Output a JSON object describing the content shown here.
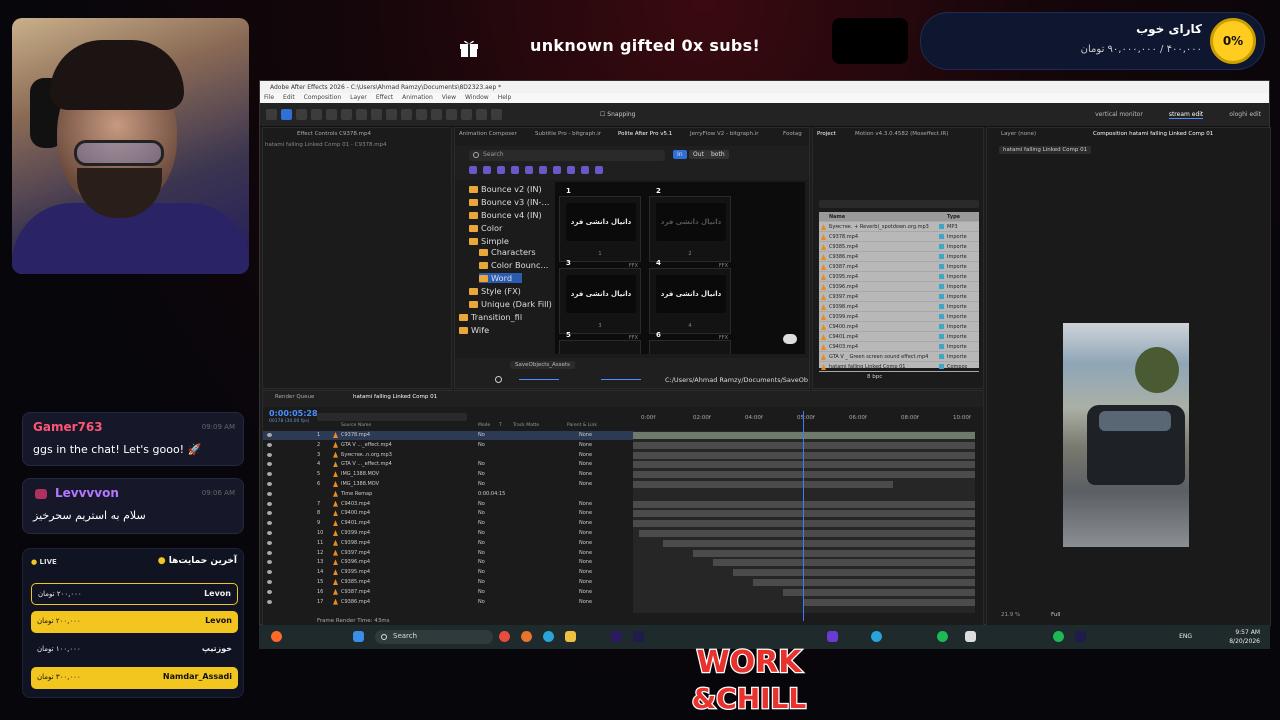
{
  "overlay": {
    "gift_text": "unknown gifted 0x subs!",
    "goal": {
      "title": "کارای خوب",
      "progress": "۴۰۰,۰۰۰ / ۹۰,۰۰۰,۰۰۰ تومان",
      "percent": "0%"
    },
    "chat": [
      {
        "user": "Gamer763",
        "time": "09:09 AM",
        "message": "ggs in the chat! Let's gooo! 🚀",
        "color": "#ff5577"
      },
      {
        "user": "Levvvvon",
        "time": "09:06 AM",
        "message": "سلام به استریم سحرخیز",
        "color": "#b477ff"
      }
    ],
    "support": {
      "live_label": "LIVE",
      "title": "آخرین حمایت‌ها",
      "rows": [
        {
          "name": "Levon",
          "amount": "۲۰۰,۰۰۰ تومان"
        },
        {
          "name": "Levon",
          "amount": "۲۰۰,۰۰۰ تومان"
        },
        {
          "name": "خوزتیپ",
          "amount": "۱۰۰,۰۰۰ تومان"
        },
        {
          "name": "Namdar_Assadi",
          "amount": "۳۰۰,۰۰۰ تومان"
        }
      ]
    },
    "logo_text": [
      "WORK",
      "&CHILL"
    ]
  },
  "app": {
    "title": "Adobe After Effects 2026 - C:\\Users\\Ahmad Ramzy\\Documents\\8D2323.aep *",
    "menu": [
      "File",
      "Edit",
      "Composition",
      "Layer",
      "Effect",
      "Animation",
      "View",
      "Window",
      "Help"
    ],
    "snapping": "Snapping",
    "workspaces": [
      "vertical monitor",
      "stream edit",
      "ologhi edit"
    ],
    "effect_controls_tab": "Effect Controls C9378.mp4",
    "effect_controls_sub": "hatami falling Linked Comp 01 - C9378.mp4",
    "ac_tabs": [
      "Animation Composer",
      "Subtitle Pro - bitgraph.ir",
      "Polite After Pro v5.1",
      "JerryFlow V2 - bitgraph.ir",
      "Footag"
    ],
    "project_tabs": [
      "Project",
      "Motion v4.3.0.4582 (Moxeffect.IR)"
    ],
    "comp_tabs": [
      "Layer (none)",
      "Composition hatami falling Linked Comp 01"
    ],
    "comp_crumb": "hatami falling Linked Comp 01",
    "search_placeholder": "Search",
    "filters": [
      "In",
      "Out",
      "both"
    ],
    "tree": [
      {
        "label": "Bounce v2 (IN)",
        "indent": 0
      },
      {
        "label": "Bounce v3 (IN-...",
        "indent": 0
      },
      {
        "label": "Bounce v4 (IN)",
        "indent": 0
      },
      {
        "label": "Color",
        "indent": 0
      },
      {
        "label": "Simple",
        "indent": 0
      },
      {
        "label": "Characters",
        "indent": 1
      },
      {
        "label": "Color Bounc...",
        "indent": 1
      },
      {
        "label": "Word",
        "indent": 1,
        "selected": true
      },
      {
        "label": "Style (FX)",
        "indent": 0
      },
      {
        "label": "Unique (Dark Fill)",
        "indent": 0
      },
      {
        "label": "Transition_fil",
        "indent": -1
      },
      {
        "label": "Wife",
        "indent": -1
      }
    ],
    "presets": [
      {
        "num": "1",
        "preview": "دانیال دانشی فرد",
        "sub": "1",
        "ffx": "FFX"
      },
      {
        "num": "2",
        "preview": "دانیال دانشی فرد",
        "sub": "2",
        "ffx": "FFX"
      },
      {
        "num": "3",
        "preview": "دانیال دانشی فرد",
        "sub": "3",
        "ffx": "FFX"
      },
      {
        "num": "4",
        "preview": "دانیال دانشی فرد",
        "sub": "4",
        "ffx": "FFX"
      },
      {
        "num": "5",
        "preview": "",
        "sub": "",
        "ffx": ""
      },
      {
        "num": "6",
        "preview": "",
        "sub": "",
        "ffx": ""
      }
    ],
    "preset_label": "SaveObjects_Assets",
    "path": "C:/Users/Ahmad Ramzy/Documents/SaveOb",
    "project_columns": [
      "Name",
      "Type"
    ],
    "project_items": [
      {
        "name": "Бумстек. + Reverb)_spotdown.org.mp3",
        "type": "MP3"
      },
      {
        "name": "C9378.mp4",
        "type": "Importe"
      },
      {
        "name": "C9385.mp4",
        "type": "Importe"
      },
      {
        "name": "C9386.mp4",
        "type": "Importe"
      },
      {
        "name": "C9387.mp4",
        "type": "Importe"
      },
      {
        "name": "C9395.mp4",
        "type": "Importe"
      },
      {
        "name": "C9396.mp4",
        "type": "Importe"
      },
      {
        "name": "C9397.mp4",
        "type": "Importe"
      },
      {
        "name": "C9398.mp4",
        "type": "Importe"
      },
      {
        "name": "C9399.mp4",
        "type": "Importe"
      },
      {
        "name": "C9400.mp4",
        "type": "Importe"
      },
      {
        "name": "C9401.mp4",
        "type": "Importe"
      },
      {
        "name": "C9403.mp4",
        "type": "Importe"
      },
      {
        "name": "GTA V _ Green screen sound effect.mp4",
        "type": "Importe"
      },
      {
        "name": "hatami falling Linked Comp 01",
        "type": "Compos"
      }
    ],
    "bpc": "8 bpc",
    "timeline_tabs": [
      "Render Queue",
      "hatami falling Linked Comp 01"
    ],
    "timecode": "0:00:05:28",
    "timecode_sub": "00178 (30.00 fps)",
    "columns": [
      "Source Name",
      "Mode",
      "T",
      "Track Matte",
      "Parent & Link"
    ],
    "ruler": [
      "0:00f",
      "02:00f",
      "04:00f",
      "05:00f",
      "06:00f",
      "08:00f",
      "10:00f"
    ],
    "layers": [
      {
        "i": "1",
        "name": "C9378.mp4",
        "mode": "No",
        "parent": "None",
        "sel": true
      },
      {
        "i": "2",
        "name": "GTA V ..._effect.mp4",
        "mode": "No",
        "parent": "None"
      },
      {
        "i": "3",
        "name": "Бумстек..n.org.mp3",
        "mode": "",
        "parent": "None"
      },
      {
        "i": "4",
        "name": "GTA V ..._effect.mp4",
        "mode": "No",
        "parent": "None"
      },
      {
        "i": "5",
        "name": "IMG_1388.MOV",
        "mode": "No",
        "parent": "None"
      },
      {
        "i": "6",
        "name": "IMG_1388.MOV",
        "mode": "No",
        "parent": "None"
      },
      {
        "i": "",
        "name": "Time Remap",
        "mode": "0:00:04:15",
        "parent": ""
      },
      {
        "i": "7",
        "name": "C9403.mp4",
        "mode": "No",
        "parent": "None"
      },
      {
        "i": "8",
        "name": "C9400.mp4",
        "mode": "No",
        "parent": "None"
      },
      {
        "i": "9",
        "name": "C9401.mp4",
        "mode": "No",
        "parent": "None"
      },
      {
        "i": "10",
        "name": "C9399.mp4",
        "mode": "No",
        "parent": "None"
      },
      {
        "i": "11",
        "name": "C9398.mp4",
        "mode": "No",
        "parent": "None"
      },
      {
        "i": "12",
        "name": "C9397.mp4",
        "mode": "No",
        "parent": "None"
      },
      {
        "i": "13",
        "name": "C9396.mp4",
        "mode": "No",
        "parent": "None"
      },
      {
        "i": "14",
        "name": "C9395.mp4",
        "mode": "No",
        "parent": "None"
      },
      {
        "i": "15",
        "name": "C9385.mp4",
        "mode": "No",
        "parent": "None"
      },
      {
        "i": "16",
        "name": "C9387.mp4",
        "mode": "No",
        "parent": "None"
      },
      {
        "i": "17",
        "name": "C9386.mp4",
        "mode": "No",
        "parent": "None"
      }
    ],
    "frame_render": "Frame Render Time: 43ms",
    "comp_zoom": "21.9 %",
    "comp_res": "Full"
  },
  "taskbar": {
    "search": "Search",
    "lang": "ENG",
    "time": "9:57 AM",
    "date": "8/20/2026"
  }
}
